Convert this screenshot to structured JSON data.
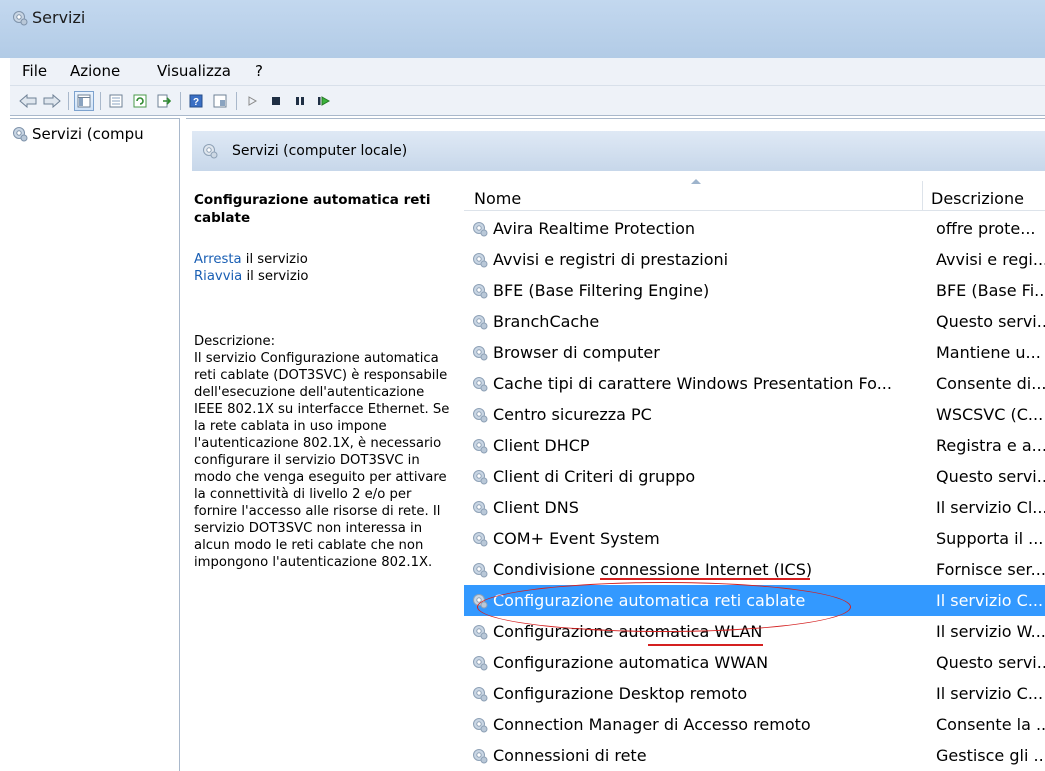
{
  "window": {
    "title": "Servizi"
  },
  "menu": {
    "file": "File",
    "action": "Azione",
    "view": "Visualizza",
    "help": "?"
  },
  "tree": {
    "root": "Servizi (compu"
  },
  "header": {
    "title": "Servizi (computer locale)"
  },
  "details": {
    "title": "Configurazione automatica reti cablate",
    "stop_link": "Arresta",
    "stop_rest": " il servizio",
    "restart_link": "Riavvia",
    "restart_rest": " il servizio",
    "desc_label": "Descrizione:",
    "desc_text": "Il servizio Configurazione automatica reti cablate (DOT3SVC) è responsabile dell'esecuzione dell'autenticazione IEEE 802.1X su interfacce Ethernet. Se la rete cablata in uso impone l'autenticazione 802.1X, è necessario configurare il servizio DOT3SVC in modo che venga eseguito per attivare la connettività di livello 2 e/o per fornire l'accesso alle risorse di rete. Il servizio DOT3SVC non interessa in alcun modo le reti cablate che non impongono l'autenticazione 802.1X."
  },
  "columns": {
    "name": "Nome",
    "description": "Descrizione"
  },
  "services": [
    {
      "name": "Avira Realtime Protection",
      "desc": "offre prote..."
    },
    {
      "name": "Avvisi e registri di prestazioni",
      "desc": "Avvisi e regi..."
    },
    {
      "name": "BFE (Base Filtering Engine)",
      "desc": "BFE (Base Fi..."
    },
    {
      "name": "BranchCache",
      "desc": "Questo servi..."
    },
    {
      "name": "Browser di computer",
      "desc": "Mantiene u..."
    },
    {
      "name": "Cache tipi di carattere Windows Presentation Fo...",
      "desc": "Consente di..."
    },
    {
      "name": "Centro sicurezza PC",
      "desc": "WSCSVC (C..."
    },
    {
      "name": "Client DHCP",
      "desc": "Registra e a..."
    },
    {
      "name": "Client di Criteri di gruppo",
      "desc": "Questo servi..."
    },
    {
      "name": "Client DNS",
      "desc": "Il servizio Cl..."
    },
    {
      "name": "COM+ Event System",
      "desc": "Supporta il ..."
    },
    {
      "name": "Condivisione connessione Internet (ICS)",
      "desc": "Fornisce ser..."
    },
    {
      "name": "Configurazione automatica reti cablate",
      "desc": "Il servizio C..."
    },
    {
      "name": "Configurazione automatica WLAN",
      "desc": "Il servizio W..."
    },
    {
      "name": "Configurazione automatica WWAN",
      "desc": "Questo servi..."
    },
    {
      "name": "Configurazione Desktop remoto",
      "desc": "Il servizio C..."
    },
    {
      "name": "Connection Manager di Accesso remoto",
      "desc": "Consente la ..."
    },
    {
      "name": "Connessioni di rete",
      "desc": "Gestisce gli ..."
    }
  ],
  "selected_index": 12,
  "colors": {
    "selection": "#3399ff",
    "annotation": "#d42020",
    "link": "#1a5fb4"
  }
}
